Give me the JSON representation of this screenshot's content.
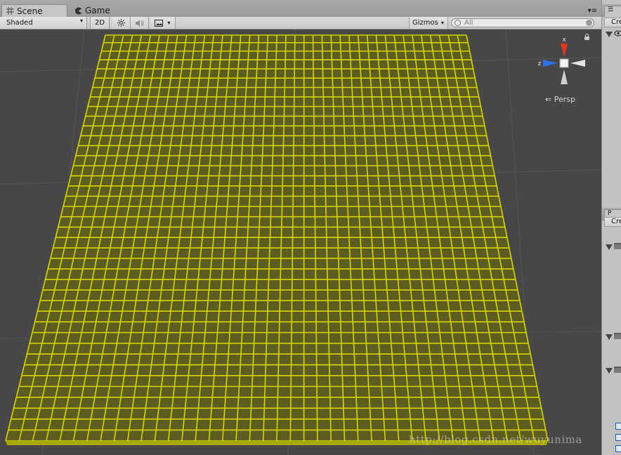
{
  "tabs": {
    "scene_label": "Scene",
    "game_label": "Game"
  },
  "toolbar": {
    "shading_mode": "Shaded",
    "mode_2d_label": "2D",
    "gizmos_label": "Gizmos",
    "search_placeholder": "All"
  },
  "viewport": {
    "projection_label": "Persp",
    "mesh_color": "#d6d600",
    "background_color": "#474747",
    "watermark": "http://blog.csdn.net/wuyunima"
  },
  "orientation_gizmo": {
    "axis_x_label": "x",
    "axis_z_label": "z",
    "x_color": "#e8321e",
    "z_color": "#2f72e8"
  },
  "right_panel": {
    "top_create_label": "Cre",
    "bottom_create_label": "Cre",
    "bottom_tab_label": "P"
  },
  "icons": [
    "scene-grid-icon",
    "game-pacman-icon",
    "sun-icon",
    "speaker-icon",
    "image-icon",
    "search-icon",
    "lock-icon",
    "eye-icon",
    "folder-icon",
    "csharp-script-icon"
  ]
}
